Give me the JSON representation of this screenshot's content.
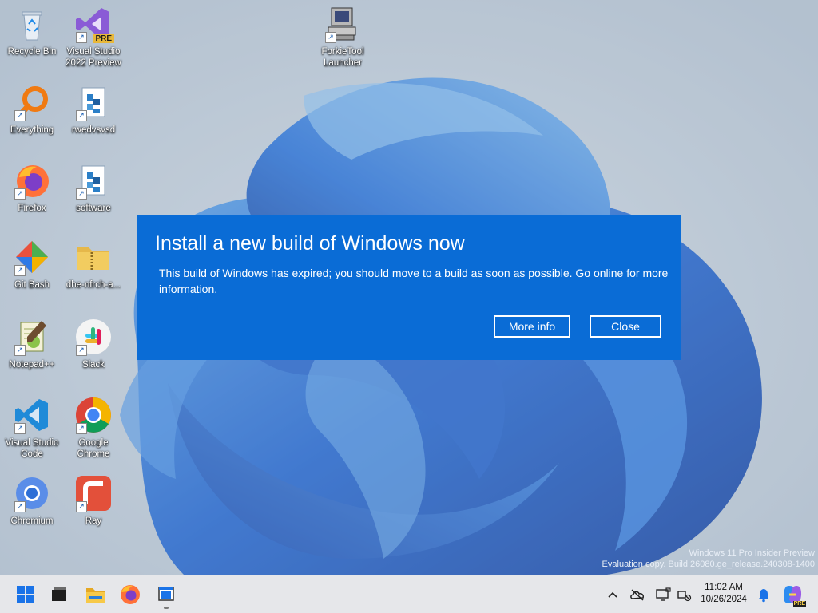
{
  "desktop": {
    "icons": [
      {
        "label": "Recycle Bin"
      },
      {
        "label": "Visual Studio 2022 Preview",
        "badge": "PRE"
      },
      {
        "label": "ForkieTool Launcher"
      },
      {
        "label": "Everything"
      },
      {
        "label": "rwedvsvsd"
      },
      {
        "label": "Firefox"
      },
      {
        "label": "software"
      },
      {
        "label": "Git Bash"
      },
      {
        "label": "dhe-nfrch-a..."
      },
      {
        "label": "Notepad++"
      },
      {
        "label": "Slack"
      },
      {
        "label": "Visual Studio Code"
      },
      {
        "label": "Google Chrome"
      },
      {
        "label": "Chromium"
      },
      {
        "label": "Ray"
      }
    ],
    "watermark": {
      "line1": "Windows 11 Pro Insider Preview",
      "line2": "Evaluation copy. Build 26080.ge_release.240308-1400"
    }
  },
  "dialog": {
    "title": "Install a new build of Windows now",
    "message": "This build of Windows has expired; you should move to a build as soon as possible. Go online for more information.",
    "more_info_label": "More info",
    "close_label": "Close",
    "background": "#0a6cd6"
  },
  "taskbar": {
    "items": [
      "start-icon",
      "task-view-icon",
      "file-explorer-icon",
      "firefox-icon",
      "active-window-icon"
    ],
    "tray": [
      "chevron-up-icon",
      "onedrive-icon",
      "display-icon",
      "network-icon"
    ],
    "time": "11:02 AM",
    "date": "10/26/2024",
    "copilot_badge": "PRE"
  }
}
